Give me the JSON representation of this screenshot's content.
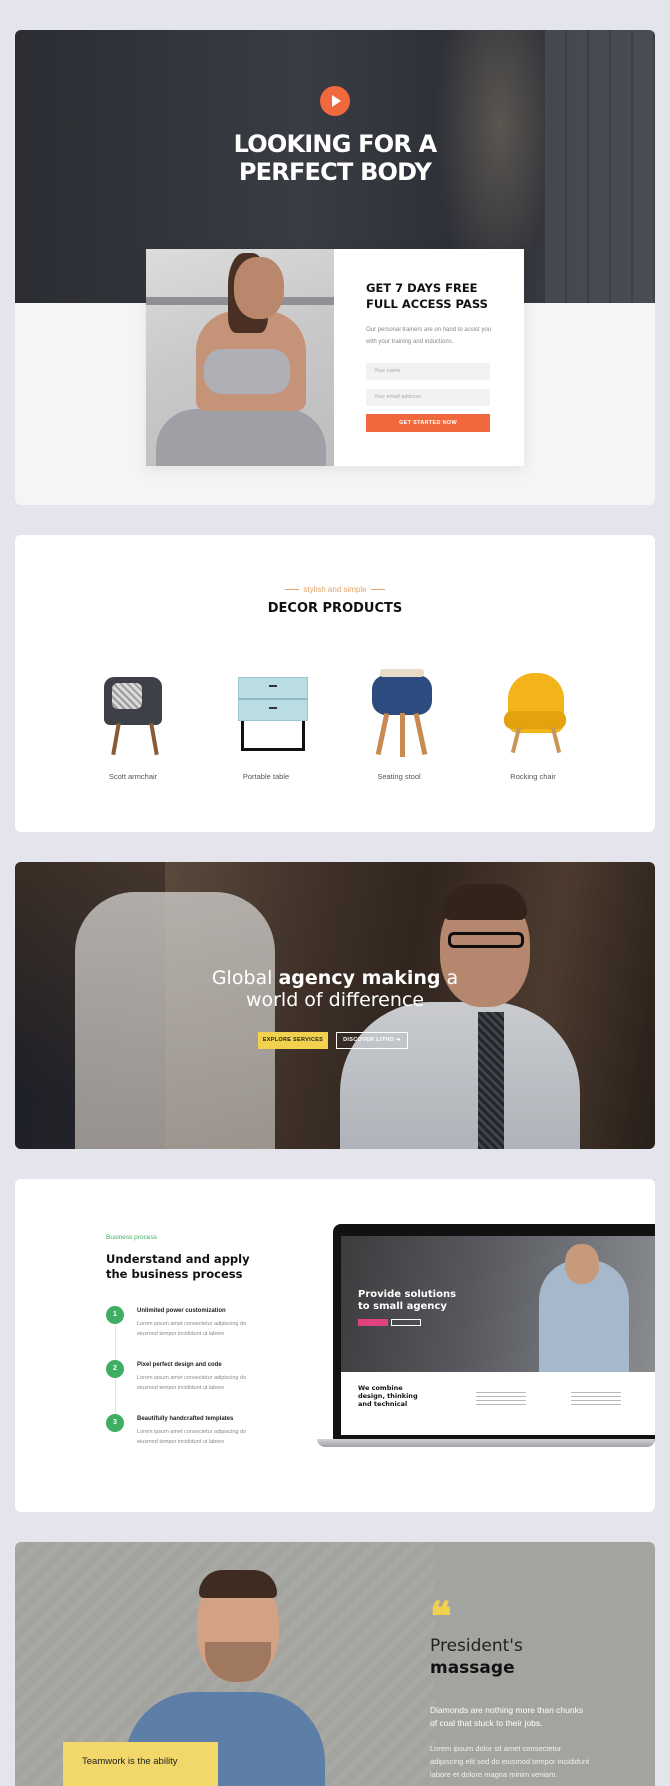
{
  "fitness": {
    "hero_title_line1": "LOOKING FOR A",
    "hero_title_line2": "PERFECT BODY",
    "pass_title_line1": "GET 7 DAYS FREE",
    "pass_title_line2": "FULL ACCESS PASS",
    "pass_text": "Our personal trainers are on hand to assist you with your training and inductions.",
    "name_placeholder": "Your name",
    "email_placeholder": "Your email address",
    "cta": "GET STARTED NOW",
    "accent": "#f2683d"
  },
  "decor": {
    "tag": "stylish and simple",
    "title": "DECOR PRODUCTS",
    "products": [
      "Scott armchair",
      "Portable table",
      "Seating stool",
      "Rocking chair"
    ]
  },
  "agency": {
    "line1_pre": "Global ",
    "line1_bold": "agency making",
    "line1_post": " a",
    "line2": "world of difference",
    "btn_primary": "EXPLORE SERVICES",
    "btn_secondary": "DISCOVER LITHO ➔",
    "accent": "#f2d14f"
  },
  "business": {
    "eyebrow": "Business process",
    "title": "Understand and apply the business process",
    "steps": [
      {
        "num": "1",
        "title": "Unlimited power customization",
        "desc": "Lorem ipsum amet consectetur adipiscing do eiusmod tempor incididunt ut labore"
      },
      {
        "num": "2",
        "title": "Pixel perfect design and code",
        "desc": "Lorem ipsum amet consectetur adipiscing do eiusmod tempor incididunt ut labore"
      },
      {
        "num": "3",
        "title": "Beautifully handcrafted templates",
        "desc": "Lorem ipsum amet consectetur adipiscing do eiusmod tempor incididunt ut labore"
      }
    ],
    "screen_headline_line1": "Provide solutions",
    "screen_headline_line2": "to small agency",
    "screen_sub_line1": "We combine",
    "screen_sub_line2": "design, thinking",
    "screen_sub_line3": "and technical",
    "accent": "#3fae63"
  },
  "president": {
    "quote_mark": "❝",
    "heading_line1": "President's",
    "heading_line2": "massage",
    "lead": "Diamonds are nothing more than chunks of coal that stuck to their jobs.",
    "body": "Lorem ipsum dolor sit amet consectetur adipiscing elit sed do eiusmod tempor incididunt labore et dolore magna minim veniam.",
    "badge": "Teamwork is the ability"
  }
}
